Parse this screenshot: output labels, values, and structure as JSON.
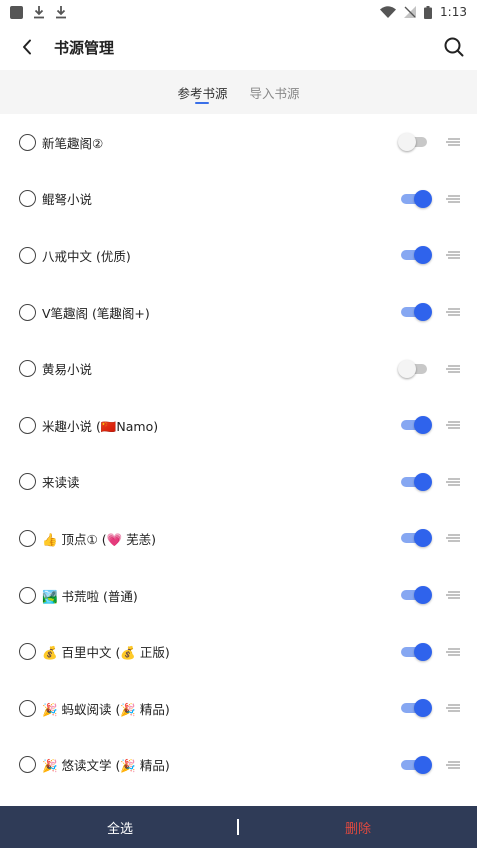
{
  "status_bar": {
    "time": "1:13"
  },
  "header": {
    "title": "书源管理",
    "back_icon": "chevron-left-icon",
    "search_icon": "search-icon"
  },
  "tabs": [
    {
      "label": "参考书源",
      "active": true
    },
    {
      "label": "导入书源",
      "active": false
    }
  ],
  "sources": [
    {
      "name": "新笔趣阁②",
      "enabled": false
    },
    {
      "name": "鲲弩小说",
      "enabled": true
    },
    {
      "name": "八戒中文 (优质)",
      "enabled": true
    },
    {
      "name": "V笔趣阁 (笔趣阁+)",
      "enabled": true
    },
    {
      "name": "黄易小说",
      "enabled": false
    },
    {
      "name": "米趣小说 (🇨🇳Namo)",
      "enabled": true
    },
    {
      "name": "来读读",
      "enabled": true
    },
    {
      "name": "👍 顶点① (💗 芜恙)",
      "enabled": true
    },
    {
      "name": "🏞️ 书荒啦 (普通)",
      "enabled": true
    },
    {
      "name": "💰 百里中文 (💰 正版)",
      "enabled": true
    },
    {
      "name": "🎉 蚂蚁阅读 (🎉 精品)",
      "enabled": true
    },
    {
      "name": "🎉 悠读文学 (🎉 精品)",
      "enabled": true
    }
  ],
  "footer": {
    "select_all_label": "全选",
    "delete_label": "删除"
  },
  "colors": {
    "accent": "#2f63ec",
    "bottom_bar": "#2f3b57",
    "delete": "#e0493f"
  }
}
